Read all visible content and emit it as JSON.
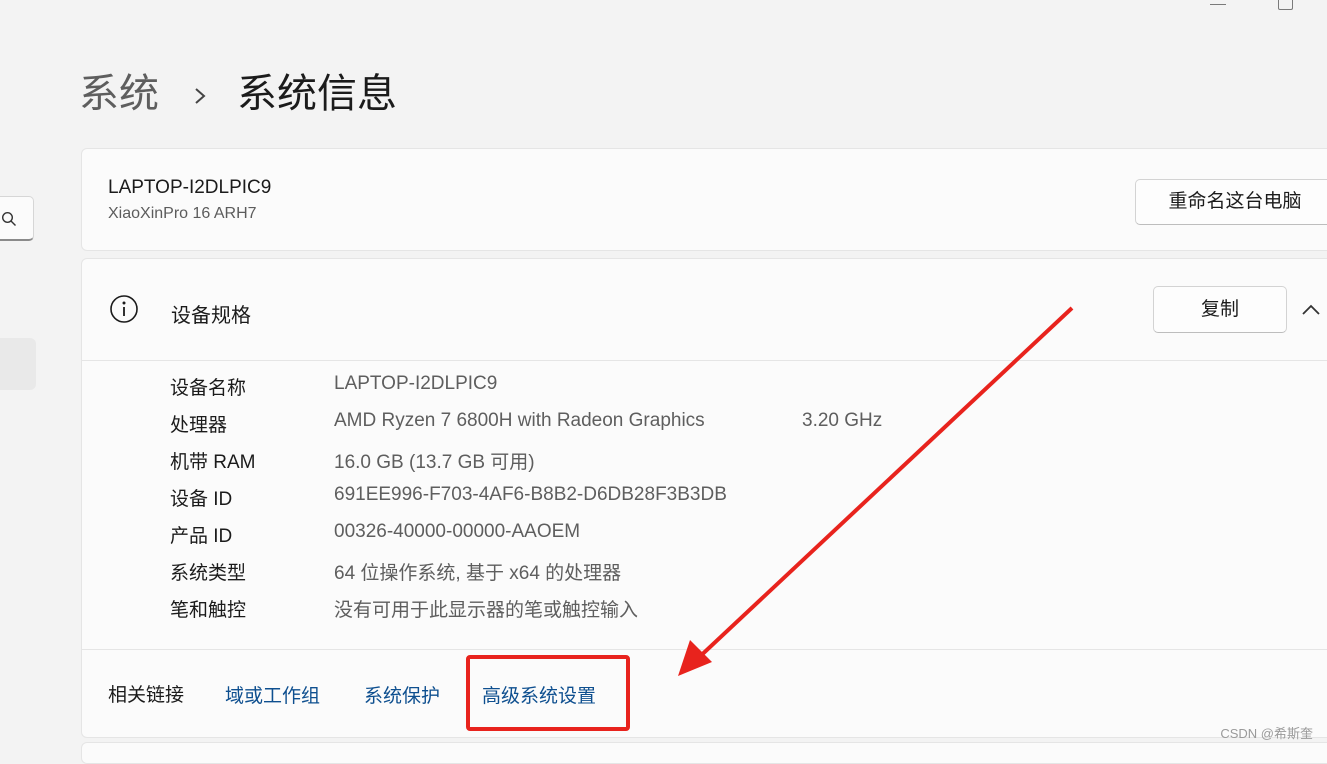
{
  "breadcrumb": {
    "parent": "系统",
    "current": "系统信息"
  },
  "window_controls": {
    "minimize_icon": "minimize-icon",
    "maximize_icon": "maximize-icon"
  },
  "sidebar": {
    "search_icon": "search-icon"
  },
  "pc_card": {
    "name": "LAPTOP-I2DLPIC9",
    "model": "XiaoXinPro 16 ARH7",
    "rename_label": "重命名这台电脑"
  },
  "spec_card": {
    "title": "设备规格",
    "copy_label": "复制",
    "icon": "info-icon",
    "rows": [
      {
        "label": "设备名称",
        "value": "LAPTOP-I2DLPIC9",
        "extra": ""
      },
      {
        "label": "处理器",
        "value": "AMD Ryzen 7 6800H with Radeon Graphics",
        "extra": "3.20 GHz"
      },
      {
        "label": "机带 RAM",
        "value": "16.0 GB (13.7 GB 可用)",
        "extra": ""
      },
      {
        "label": "设备 ID",
        "value": "691EE996-F703-4AF6-B8B2-D6DB28F3B3DB",
        "extra": ""
      },
      {
        "label": "产品 ID",
        "value": "00326-40000-00000-AAOEM",
        "extra": ""
      },
      {
        "label": "系统类型",
        "value": "64 位操作系统, 基于 x64 的处理器",
        "extra": ""
      },
      {
        "label": "笔和触控",
        "value": "没有可用于此显示器的笔或触控输入",
        "extra": ""
      }
    ]
  },
  "related": {
    "title": "相关链接",
    "links": [
      "域或工作组",
      "系统保护",
      "高级系统设置"
    ]
  },
  "colors": {
    "annotation": "#e8231d",
    "link": "#0e4f8f"
  },
  "watermark": "CSDN @希斯奎"
}
